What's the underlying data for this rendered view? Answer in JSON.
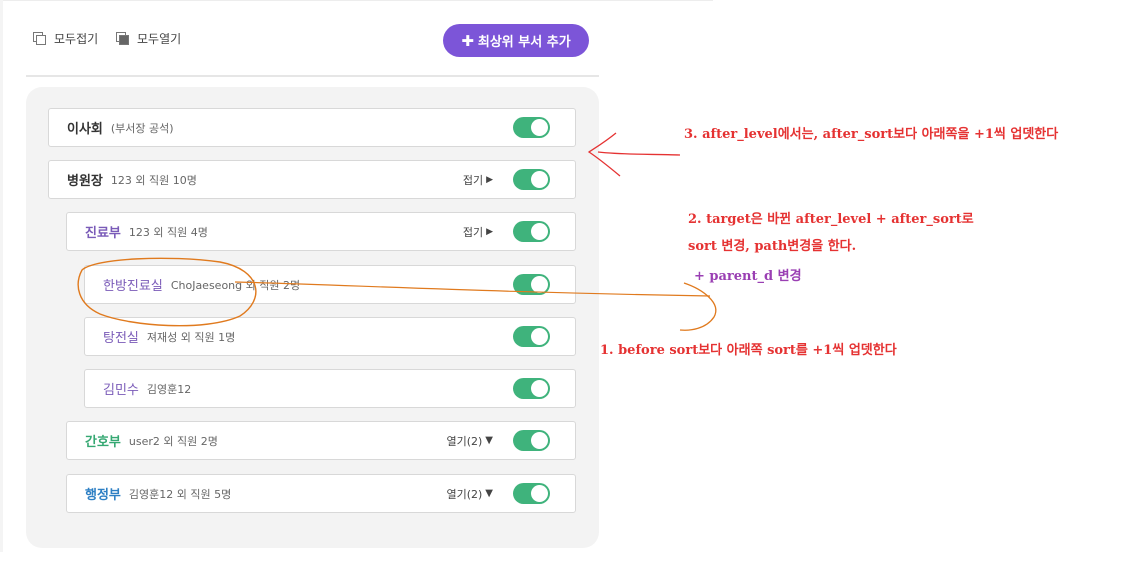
{
  "toolbar": {
    "collapse_all": "모두접기",
    "expand_all": "모두열기",
    "add_top": "최상위 부서 추가"
  },
  "rows": [
    {
      "name": "이사회",
      "sub": "(부서장 공석)",
      "fold": "",
      "name_color": "#333333"
    },
    {
      "name": "병원장",
      "sub": "123 외 직원 10명",
      "fold": "접기",
      "fold_icon": "▶",
      "name_color": "#333333"
    },
    {
      "name": "진료부",
      "sub": "123 외 직원 4명",
      "fold": "접기",
      "fold_icon": "▶",
      "name_color": "#7a5bb8"
    },
    {
      "name": "한방진료실",
      "sub": "ChoJaeseong 외 직원 2명",
      "fold": "",
      "name_color": "#7a5bb8"
    },
    {
      "name": "탕전실",
      "sub": "져재성 외 직원 1명",
      "fold": "",
      "name_color": "#7a5bb8"
    },
    {
      "name": "김민수",
      "sub": "김영훈12",
      "fold": "",
      "name_color": "#7a5bb8"
    },
    {
      "name": "간호부",
      "sub": "user2 외 직원 2명",
      "fold": "열기(2)",
      "fold_icon": "▼",
      "name_color": "#35a872"
    },
    {
      "name": "행정부",
      "sub": "김영훈12 외 직원 5명",
      "fold": "열기(2)",
      "fold_icon": "▼",
      "name_color": "#2d7fc4"
    }
  ],
  "annotations": {
    "note3": "3. after_level에서는, after_sort보다 아래쪽을 +1씩 업뎃한다",
    "note2_line1": "2. target은 바뀐 after_level + after_sort로",
    "note2_line2": "sort 변경, path변경을 한다.",
    "note2_line3": "+ parent_d 변경",
    "note1": "1. before sort보다 아래쪽 sort를 +1씩 업뎃한다"
  },
  "colors": {
    "accent": "#7c55d8",
    "toggle_on": "#3fb37c",
    "annotation_red": "#e53232",
    "annotation_purple": "#9a3fb3",
    "sketch_orange": "#e07a1e"
  }
}
